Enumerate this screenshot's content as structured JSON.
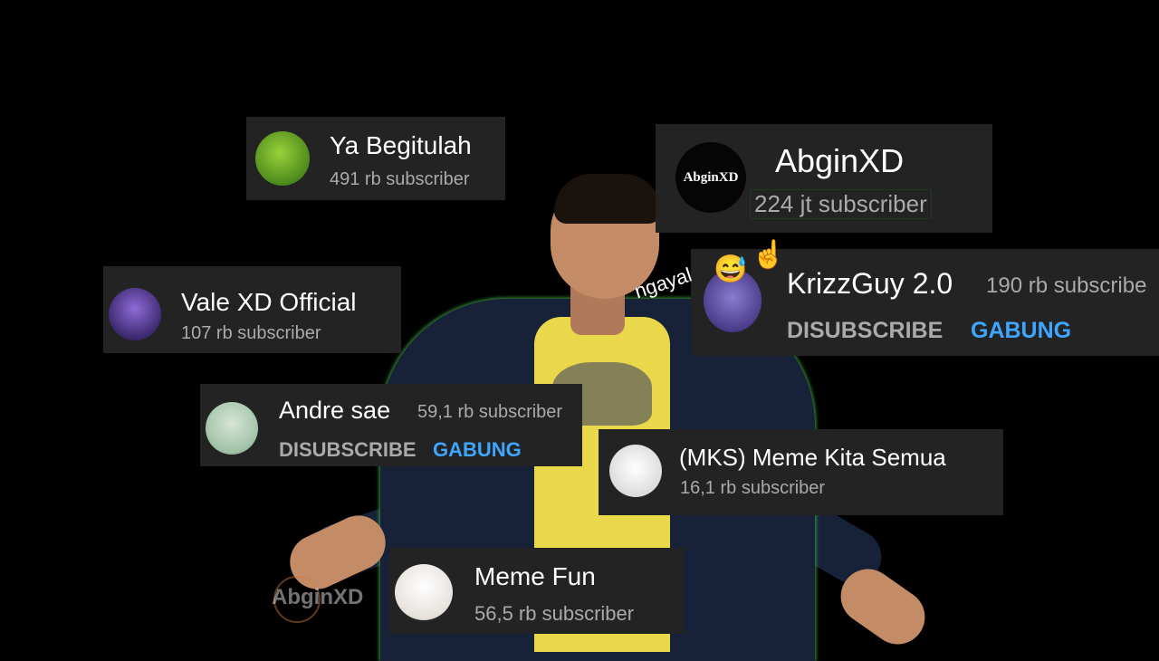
{
  "cards": [
    {
      "name": "Ya Begitulah",
      "subs": "491 rb subscriber"
    },
    {
      "name": "AbginXD",
      "subs": "224 jt subscriber",
      "avatar_text": "AbginXD"
    },
    {
      "name": "KrizzGuy 2.0",
      "subs": "190 rb subscribe",
      "unsubscribe": "DISUBSCRIBE",
      "join": "GABUNG"
    },
    {
      "name": "Vale XD Official",
      "subs": "107 rb subscriber"
    },
    {
      "name": "Andre sae",
      "subs": "59,1 rb subscriber",
      "unsubscribe": "DISUBSCRIBE",
      "join": "GABUNG"
    },
    {
      "name": "(MKS) Meme Kita Semua",
      "subs": "16,1 rb subscriber"
    },
    {
      "name": "Meme Fun",
      "subs": "56,5 rb subscriber"
    }
  ],
  "annotation": {
    "text": "ngayal",
    "emoji_1": "😅",
    "emoji_2": "☝"
  },
  "watermark": "AbginXD",
  "colors": {
    "card_bg": "#232323",
    "subs_text": "#aaaaaa",
    "join_blue": "#3ea6ff",
    "glow": "#3ea23e"
  }
}
